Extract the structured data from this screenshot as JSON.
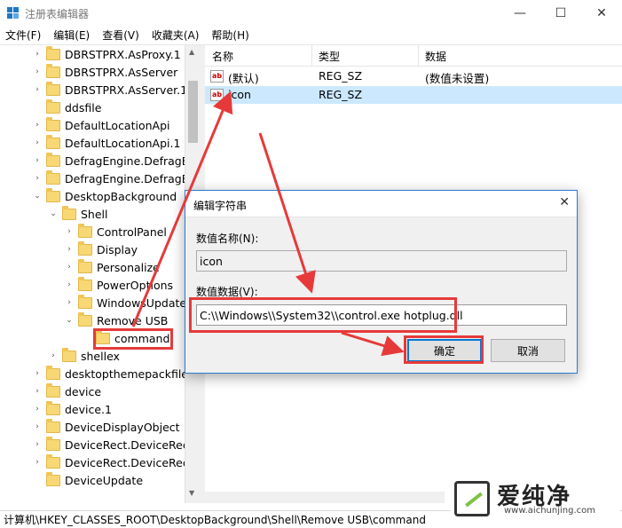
{
  "window": {
    "title": "注册表编辑器",
    "minimize": "—",
    "maximize": "☐",
    "close": "✕"
  },
  "menu": [
    "文件(F)",
    "编辑(E)",
    "查看(V)",
    "收藏夹(A)",
    "帮助(H)"
  ],
  "tree": [
    {
      "label": "DBRSTPRX.AsProxy.1",
      "state": "collapsed"
    },
    {
      "label": "DBRSTPRX.AsServer",
      "state": "collapsed"
    },
    {
      "label": "DBRSTPRX.AsServer.1",
      "state": "collapsed"
    },
    {
      "label": "ddsfile",
      "state": "leaf"
    },
    {
      "label": "DefaultLocationApi",
      "state": "collapsed"
    },
    {
      "label": "DefaultLocationApi.1",
      "state": "collapsed"
    },
    {
      "label": "DefragEngine.DefragEr",
      "state": "collapsed"
    },
    {
      "label": "DefragEngine.DefragEr",
      "state": "collapsed"
    },
    {
      "label": "DesktopBackground",
      "state": "expanded"
    },
    {
      "label": "Shell",
      "state": "expanded"
    },
    {
      "label": "ControlPanel",
      "state": "collapsed"
    },
    {
      "label": "Display",
      "state": "collapsed"
    },
    {
      "label": "Personalize",
      "state": "collapsed"
    },
    {
      "label": "PowerOptions",
      "state": "collapsed"
    },
    {
      "label": "WindowsUpdate",
      "state": "collapsed"
    },
    {
      "label": "Remove USB",
      "state": "expanded"
    },
    {
      "label": "command",
      "state": "leaf"
    },
    {
      "label": "shellex",
      "state": "collapsed"
    },
    {
      "label": "desktopthemepackfile",
      "state": "collapsed"
    },
    {
      "label": "device",
      "state": "collapsed"
    },
    {
      "label": "device.1",
      "state": "collapsed"
    },
    {
      "label": "DeviceDisplayObject",
      "state": "collapsed"
    },
    {
      "label": "DeviceRect.DeviceRect",
      "state": "collapsed"
    },
    {
      "label": "DeviceRect.DeviceRect.",
      "state": "collapsed"
    },
    {
      "label": "DeviceUpdate",
      "state": "leaf"
    }
  ],
  "list": {
    "headers": {
      "name": "名称",
      "type": "类型",
      "data": "数据"
    },
    "rows": [
      {
        "name": "(默认)",
        "type": "REG_SZ",
        "data": "(数值未设置)"
      },
      {
        "name": "icon",
        "type": "REG_SZ",
        "data": ""
      }
    ]
  },
  "status": "计算机\\HKEY_CLASSES_ROOT\\DesktopBackground\\Shell\\Remove USB\\command",
  "dialog": {
    "title": "编辑字符串",
    "name_label": "数值名称(N):",
    "name_value": "icon",
    "data_label": "数值数据(V):",
    "data_value": "C:\\\\Windows\\\\System32\\\\control.exe hotplug.dll",
    "ok": "确定",
    "cancel": "取消"
  },
  "watermark": {
    "text": "爱纯净",
    "url": "www.aichunjing.com"
  },
  "colors": {
    "accent": "#0078d7",
    "highlight": "#e63a3a",
    "selection": "#cce8ff",
    "folder": "#f8d775"
  }
}
